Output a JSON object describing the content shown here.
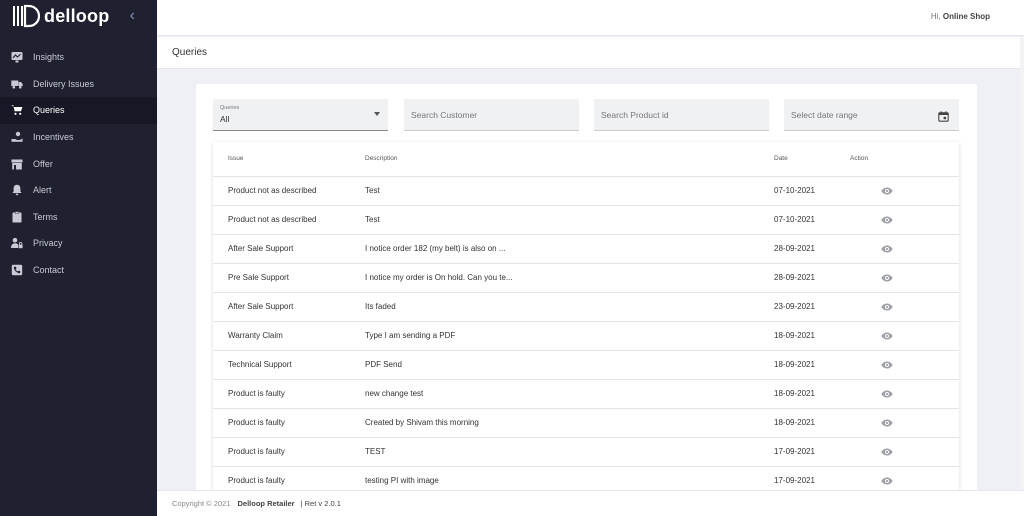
{
  "brand": {
    "name": "delloop"
  },
  "sidebar": {
    "items": [
      {
        "label": "Insights",
        "icon": "chart-icon",
        "active": false
      },
      {
        "label": "Delivery Issues",
        "icon": "truck-icon",
        "active": false
      },
      {
        "label": "Queries",
        "icon": "cart-icon",
        "active": true
      },
      {
        "label": "Incentives",
        "icon": "hand-coin-icon",
        "active": false
      },
      {
        "label": "Offer",
        "icon": "store-icon",
        "active": false
      },
      {
        "label": "Alert",
        "icon": "bell-icon",
        "active": false
      },
      {
        "label": "Terms",
        "icon": "clipboard-icon",
        "active": false
      },
      {
        "label": "Privacy",
        "icon": "user-lock-icon",
        "active": false
      },
      {
        "label": "Contact",
        "icon": "phone-icon",
        "active": false
      }
    ]
  },
  "header": {
    "greeting": "Hi,",
    "user": "Online Shop"
  },
  "page": {
    "title": "Queries"
  },
  "filters": {
    "queries_label": "Queries",
    "queries_value": "All",
    "customer_placeholder": "Search Customer",
    "product_placeholder": "Search Product id",
    "date_placeholder": "Select date range"
  },
  "table": {
    "headers": {
      "issue": "Issue",
      "description": "Description",
      "date": "Date",
      "action": "Action"
    },
    "rows": [
      {
        "issue": "Product not as described",
        "description": "Test",
        "date": "07-10-2021"
      },
      {
        "issue": "Product not as described",
        "description": "Test",
        "date": "07-10-2021"
      },
      {
        "issue": "After Sale Support",
        "description": "I notice order 182 (my belt) is also on ...",
        "date": "28-09-2021"
      },
      {
        "issue": "Pre Sale Support",
        "description": "I notice my order is On hold. Can you te...",
        "date": "28-09-2021"
      },
      {
        "issue": "After Sale Support",
        "description": "Its faded",
        "date": "23-09-2021"
      },
      {
        "issue": "Warranty Claim",
        "description": "Type I am sending a PDF",
        "date": "18-09-2021"
      },
      {
        "issue": "Technical Support",
        "description": "PDF Send",
        "date": "18-09-2021"
      },
      {
        "issue": "Product is faulty",
        "description": "new change test",
        "date": "18-09-2021"
      },
      {
        "issue": "Product is faulty",
        "description": "Created by Shivam this morning",
        "date": "18-09-2021"
      },
      {
        "issue": "Product is faulty",
        "description": "TEST",
        "date": "17-09-2021"
      },
      {
        "issue": "Product is faulty",
        "description": "testing PI with image",
        "date": "17-09-2021"
      }
    ]
  },
  "footer": {
    "copyright": "Copyright © 2021",
    "company": "Delloop Retailer",
    "version": "| Ret v 2.0.1"
  },
  "colors": {
    "sidebar_bg": "#1f2130",
    "sidebar_active_bg": "#171826",
    "page_bg": "#eef0f5",
    "filter_bg": "#f0f1f3"
  }
}
